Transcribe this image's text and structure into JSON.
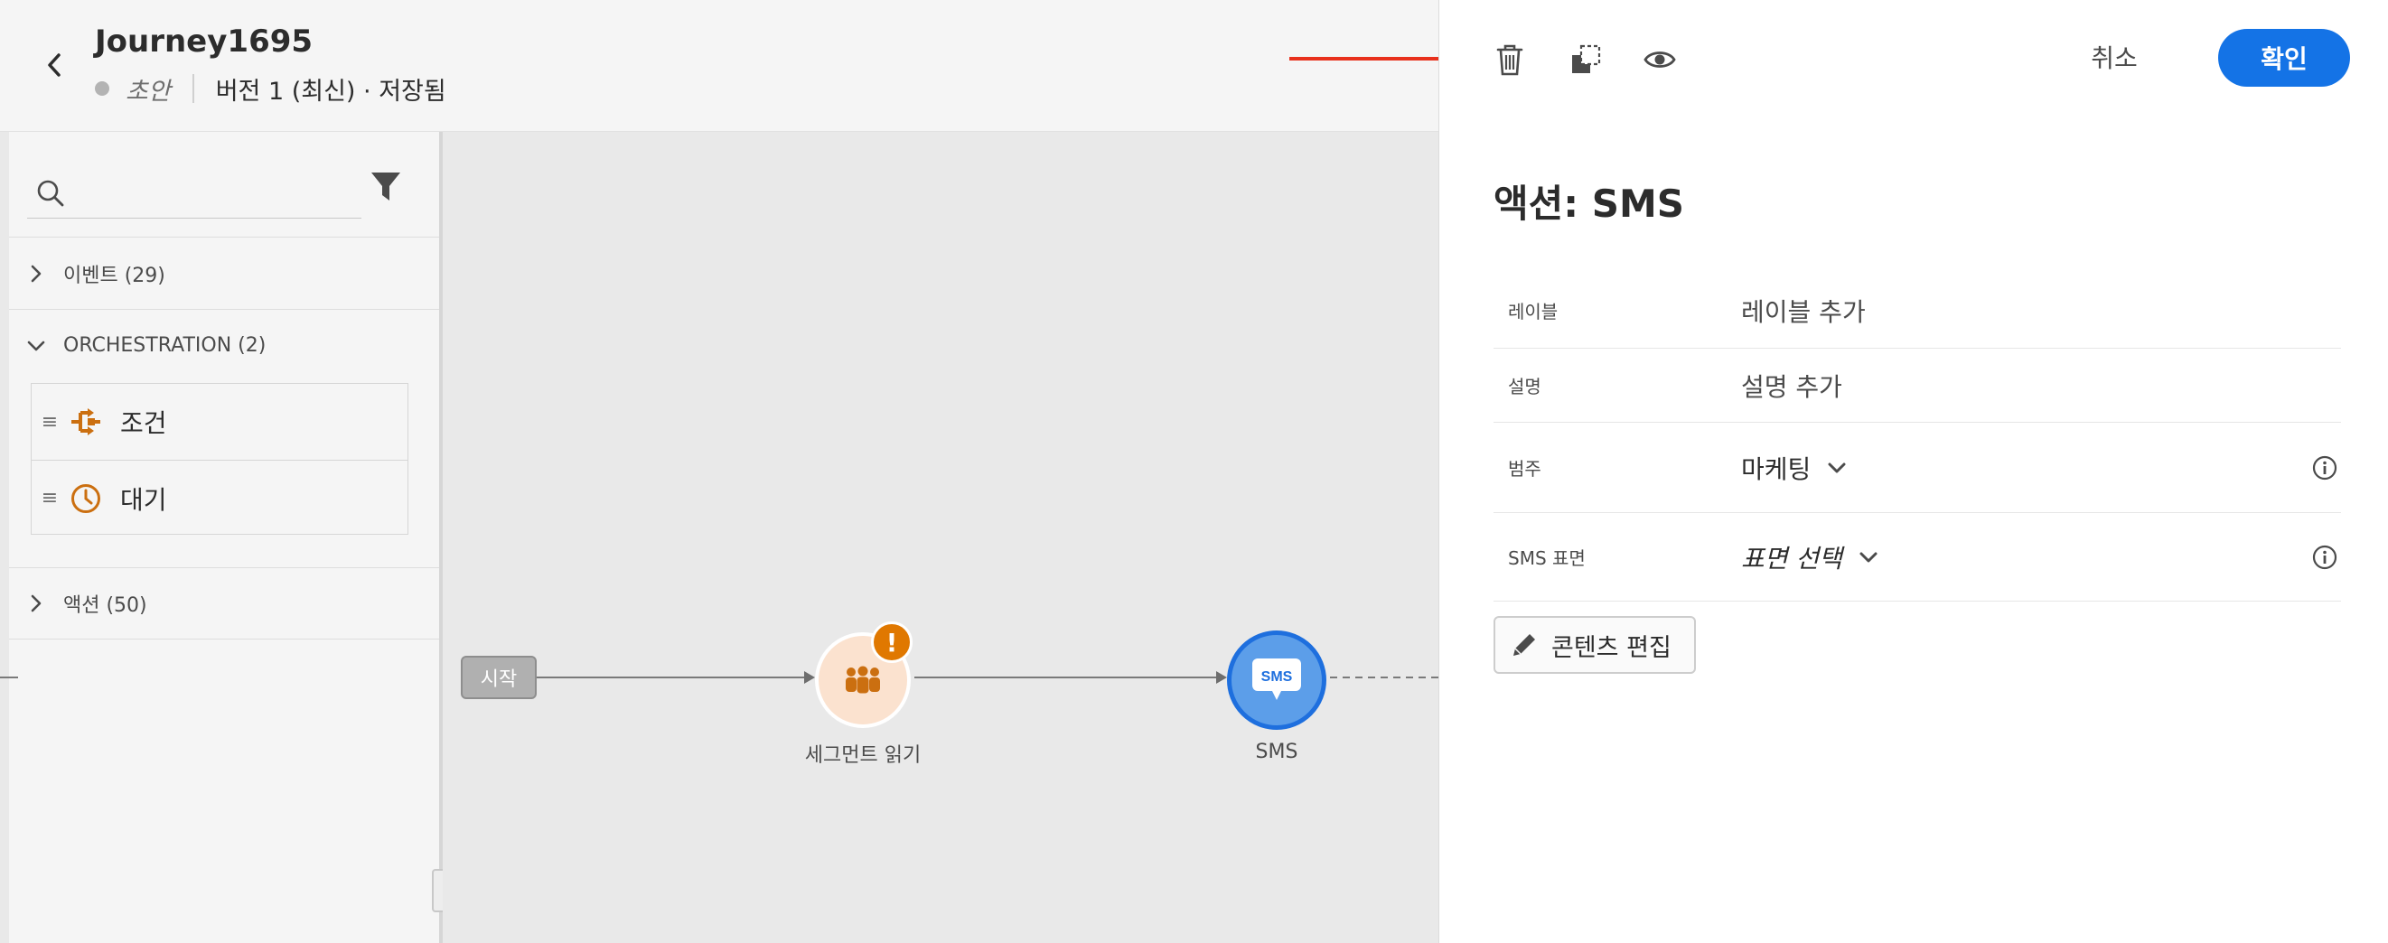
{
  "journey": {
    "title": "Journey1695",
    "status": "초안",
    "version": "버전 1 (최신) · 저장됨"
  },
  "palette": {
    "search_placeholder": "",
    "categories": [
      {
        "label": "이벤트 (29)",
        "expanded": false
      },
      {
        "label": "ORCHESTRATION (2)",
        "expanded": true
      },
      {
        "label": "액션 (50)",
        "expanded": false
      }
    ],
    "orchestration_items": [
      {
        "label": "조건",
        "icon": "condition-icon"
      },
      {
        "label": "대기",
        "icon": "clock-icon"
      }
    ]
  },
  "canvas": {
    "start_label": "시작",
    "nodes": [
      {
        "label": "세그먼트 읽기",
        "icon": "people-icon",
        "warning": "!"
      },
      {
        "label": "SMS",
        "icon": "sms-icon",
        "badge": "SMS"
      }
    ]
  },
  "panel": {
    "cancel_label": "취소",
    "confirm_label": "확인",
    "title": "액션: SMS",
    "fields": [
      {
        "label": "레이블",
        "value": "레이블 추가"
      },
      {
        "label": "설명",
        "value": "설명 추가"
      },
      {
        "label": "범주",
        "value": "마케팅"
      },
      {
        "label": "SMS 표면",
        "value": "표면 선택"
      }
    ],
    "edit_content_label": "콘텐츠 편집"
  },
  "colors": {
    "accent": "#1473e6",
    "warning": "#e07800",
    "orchestration_icon": "#cb6f10",
    "annotation_arrow": "#e8301c"
  }
}
